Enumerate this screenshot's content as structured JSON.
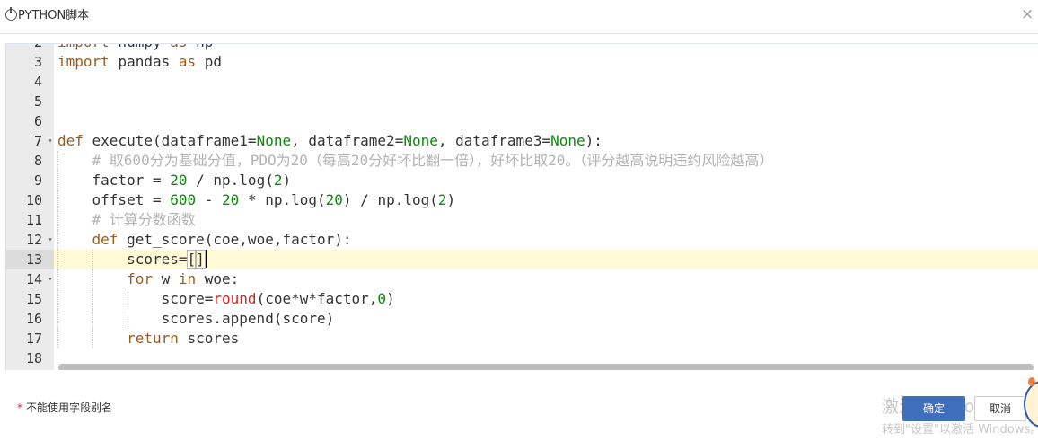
{
  "dialog": {
    "title": "PYTHON脚本",
    "close_icon": "close-icon"
  },
  "editor": {
    "lines": [
      {
        "n": "2",
        "text": "import numpy as np"
      },
      {
        "n": "3",
        "text": "import pandas as pd"
      },
      {
        "n": "4",
        "text": ""
      },
      {
        "n": "5",
        "text": ""
      },
      {
        "n": "6",
        "text": ""
      },
      {
        "n": "7",
        "text": "def execute(dataframe1=None, dataframe2=None, dataframe3=None):"
      },
      {
        "n": "8",
        "text": "    # 取600分为基础分值，PDO为20（每高20分好坏比翻一倍），好坏比取20。（评分越高说明违约风险越高）"
      },
      {
        "n": "9",
        "text": "    factor = 20 / np.log(2)"
      },
      {
        "n": "10",
        "text": "    offset = 600 - 20 * np.log(20) / np.log(2)"
      },
      {
        "n": "11",
        "text": "    # 计算分数函数"
      },
      {
        "n": "12",
        "text": "    def get_score(coe,woe,factor):"
      },
      {
        "n": "13",
        "text": "        scores=[]"
      },
      {
        "n": "14",
        "text": "        for w in woe:"
      },
      {
        "n": "15",
        "text": "            score=round(coe*w*factor,0)"
      },
      {
        "n": "16",
        "text": "            scores.append(score)"
      },
      {
        "n": "17",
        "text": "        return scores"
      },
      {
        "n": "18",
        "text": ""
      }
    ],
    "active_line": "13"
  },
  "footer": {
    "hint_star": "*",
    "hint": "不能使用字段别名",
    "ok_label": "确定",
    "cancel_label": "取消",
    "watermark_title": "激活 Windows",
    "watermark_sub": "转到\"设置\"以激活 Windows。"
  },
  "colors": {
    "keyword": "#a25a18",
    "number": "#0a8a0a",
    "comment": "#b3b3b3",
    "builtin": "#dd2020",
    "primary_button": "#3f6ebd",
    "active_line": "#fffbd8"
  }
}
